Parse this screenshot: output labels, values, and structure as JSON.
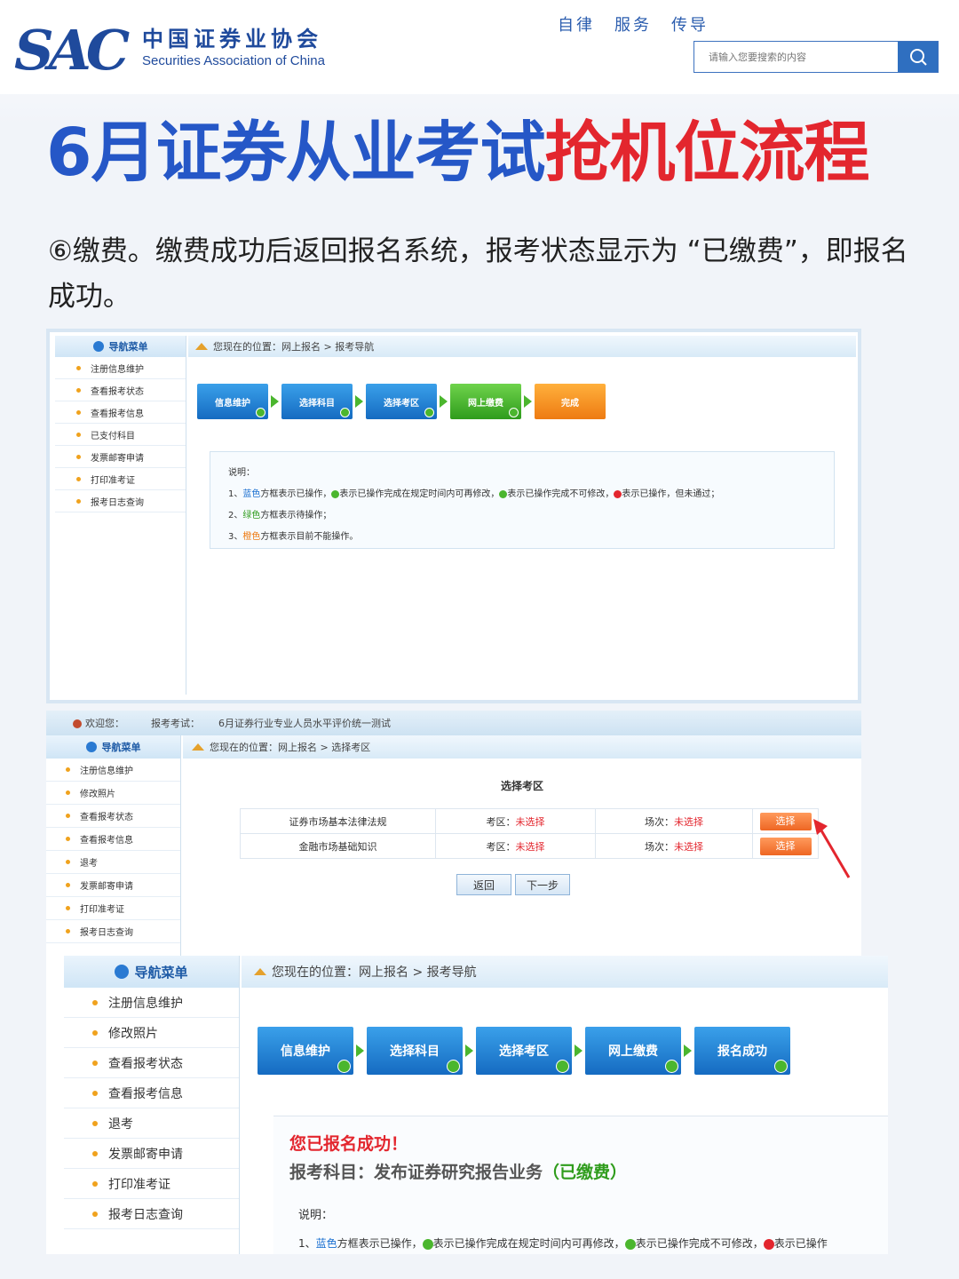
{
  "header": {
    "logo_abbr": "SAC",
    "logo_cn": "中国证券业协会",
    "logo_en": "Securities Association of China",
    "motto": [
      "自律",
      "服务",
      "传导"
    ],
    "search_placeholder": "请输入您要搜索的内容"
  },
  "title": {
    "part1": "6月证券从业考试",
    "part2": "抢机位流程"
  },
  "description": "⑥缴费。缴费成功后返回报名系统，报考状态显示为 “已缴费”，即报名成功。",
  "colors": {
    "brand_blue": "#1f4a9c",
    "title_blue": "#2557c7",
    "title_red": "#e3262e",
    "step_blue": "#1a78cf",
    "step_green": "#3fae25",
    "step_orange": "#f08a1c"
  },
  "shot1": {
    "nav_title": "导航菜单",
    "nav_items": [
      "注册信息维护",
      "查看报考状态",
      "查看报考信息",
      "已支付科目",
      "发票邮寄申请",
      "打印准考证",
      "报考日志查询"
    ],
    "crumb": "您现在的位置：网上报名  >  报考导航",
    "steps": [
      "信息维护",
      "选择科目",
      "选择考区",
      "网上缴费",
      "完成"
    ],
    "note_title": "说明：",
    "note_line1_a": "1、",
    "note_line1_b": "蓝色",
    "note_line1_c": "方框表示已操作，",
    "note_line1_d": "表示已操作完成在规定时间内可再修改，",
    "note_line1_e": "表示已操作完成不可修改，",
    "note_line1_f": "表示已操作，但未通过；",
    "note_line2_a": "2、",
    "note_line2_b": "绿色",
    "note_line2_c": "方框表示待操作；",
    "note_line3_a": "3、",
    "note_line3_b": "橙色",
    "note_line3_c": "方框表示目前不能操作。"
  },
  "shot2": {
    "welcome": "欢迎您：",
    "exam_label": "报考考试：",
    "exam_name": "6月证券行业专业人员水平评价统一测试",
    "nav_title": "导航菜单",
    "nav_items": [
      "注册信息维护",
      "修改照片",
      "查看报考状态",
      "查看报考信息",
      "退考",
      "发票邮寄申请",
      "打印准考证",
      "报考日志查询"
    ],
    "crumb": "您现在的位置：网上报名  >  选择考区",
    "section_title": "选择考区",
    "rows": [
      {
        "subject": "证券市场基本法律法规",
        "area_label": "考区：",
        "area_value": "未选择",
        "session_label": "场次：",
        "session_value": "未选择",
        "action": "选择"
      },
      {
        "subject": "金融市场基础知识",
        "area_label": "考区：",
        "area_value": "未选择",
        "session_label": "场次：",
        "session_value": "未选择",
        "action": "选择"
      }
    ],
    "back_button": "返回",
    "next_button": "下一步"
  },
  "shot3": {
    "nav_title": "导航菜单",
    "nav_items": [
      "注册信息维护",
      "修改照片",
      "查看报考状态",
      "查看报考信息",
      "退考",
      "发票邮寄申请",
      "打印准考证",
      "报考日志查询"
    ],
    "crumb": "您现在的位置：网上报名  >  报考导航",
    "steps": [
      "信息维护",
      "选择科目",
      "选择考区",
      "网上缴费",
      "报名成功"
    ],
    "success": "您已报名成功！",
    "subject_label": "报考科目：发布证券研究报告业务",
    "subject_status": "（已缴费）",
    "note_title": "说明：",
    "note_line1_a": "1、",
    "note_line1_b": "蓝色",
    "note_line1_c": "方框表示已操作，",
    "note_line1_d": "表示已操作完成在规定时间内可再修改，",
    "note_line1_e": "表示已操作完成不可修改，",
    "note_line1_f": "表示已操作"
  }
}
